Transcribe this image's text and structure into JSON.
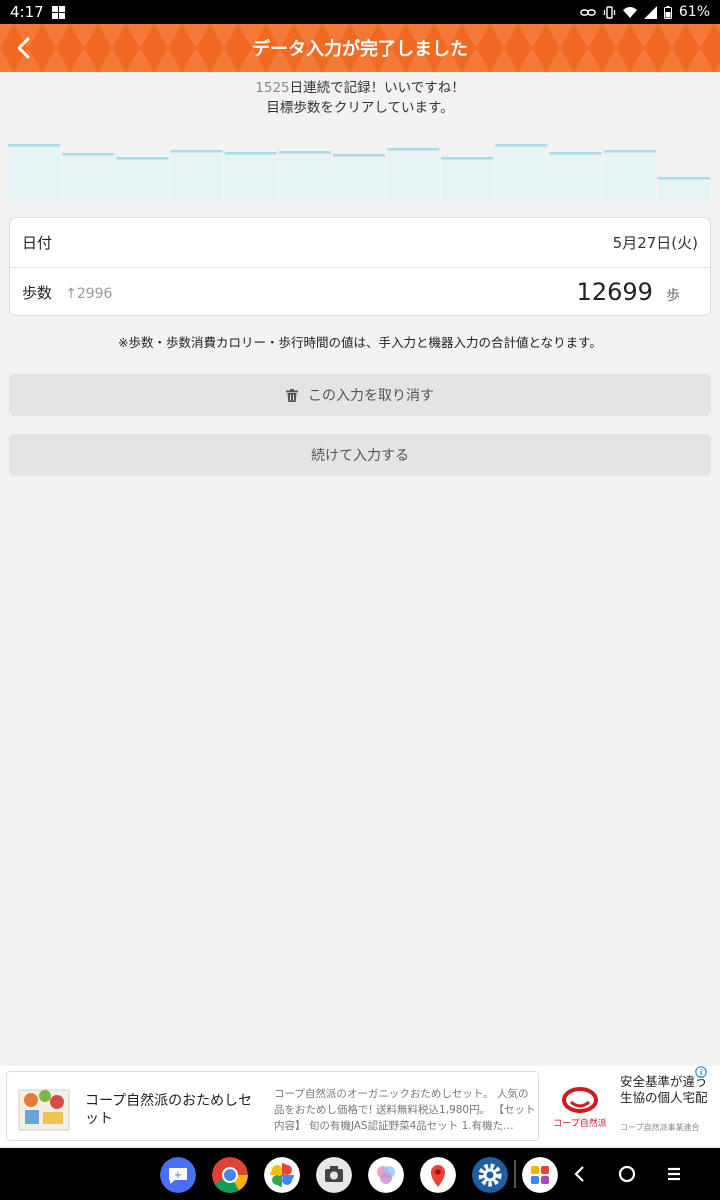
{
  "status_bar": {
    "time": "4:17",
    "battery": "61%"
  },
  "header": {
    "title": "データ入力が完了しました"
  },
  "streak": {
    "days": "1525",
    "line1_suffix": "日連続で記録！いいですね！",
    "line2": "目標歩数をクリアしています。"
  },
  "chart_data": {
    "type": "bar",
    "values": [
      58,
      49,
      45,
      52,
      50,
      51,
      48,
      54,
      45,
      58,
      50,
      52,
      25
    ],
    "ylim": [
      0,
      66
    ],
    "colors": {
      "fill": "#e6f4f6",
      "top": "#a9dce6"
    }
  },
  "record": {
    "date_label": "日付",
    "date_value": "5月27日(火)",
    "steps_label": "歩数",
    "steps_diff": "↑2996",
    "steps_value": "12699",
    "steps_unit": "歩"
  },
  "note": "※歩数・歩数消費カロリー・歩行時間の値は、手入力と機器入力の合計値となります。",
  "buttons": {
    "cancel_label": "この入力を取り消す",
    "continue_label": "続けて入力する"
  },
  "ad": {
    "title": "コープ自然派のおためしセット",
    "description": "コープ自然派のオーガニックおためしセット。 人気の品をおためし価格で! 送料無料税込1,980円。 【セット内容】 旬の有機JAS認証野菜4品セット 1.有機た…",
    "brand_title": "安全基準が違う生協の個人宅配",
    "brand_logo_text": "コープ自然派",
    "brand_sub": "コープ自然派事業連合"
  },
  "theme": {
    "accent": "#f26a22"
  }
}
